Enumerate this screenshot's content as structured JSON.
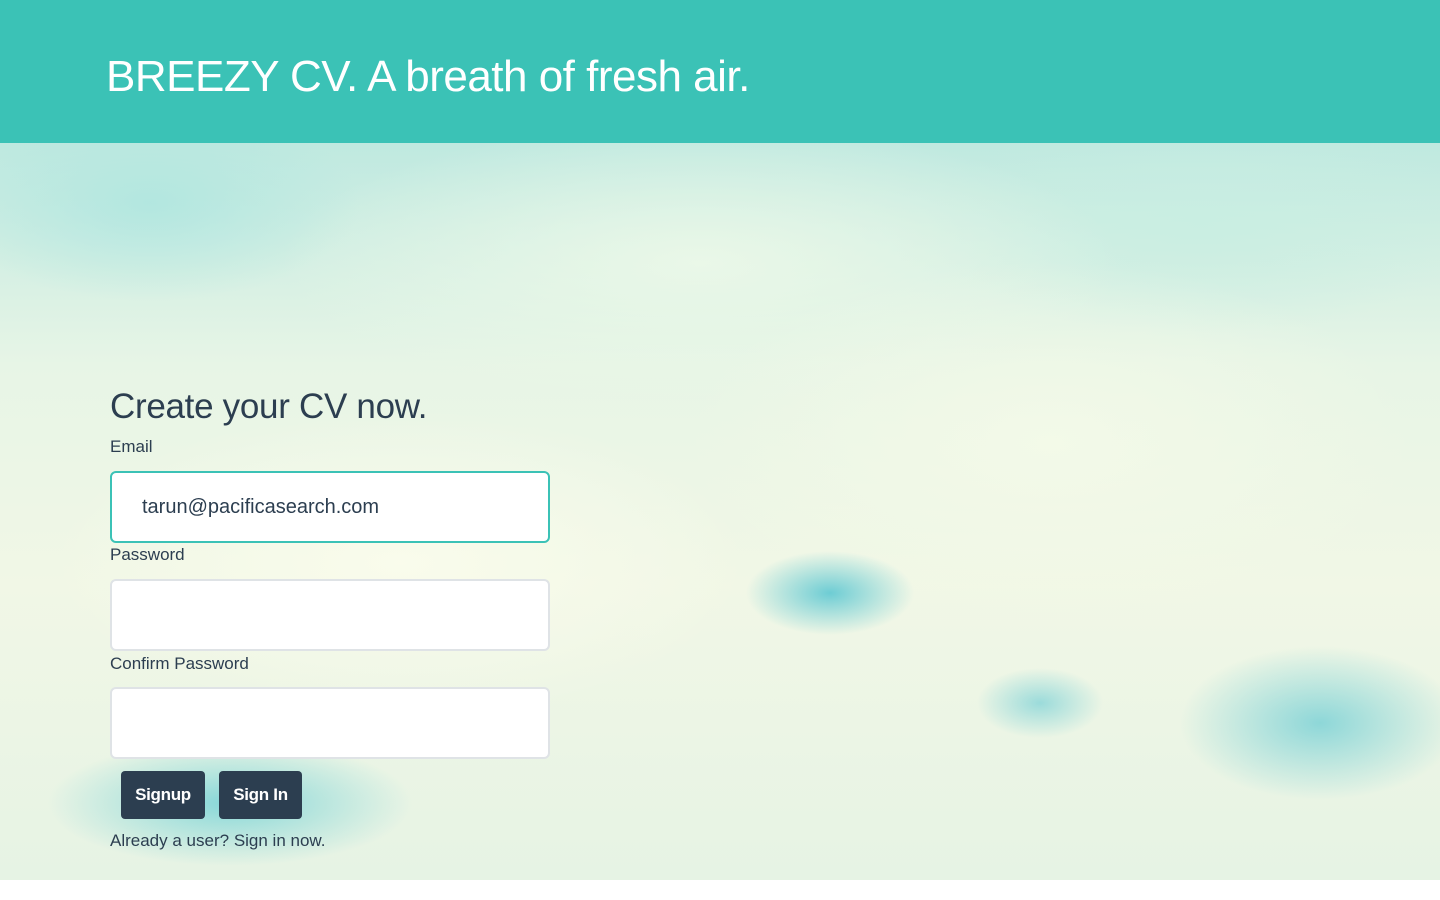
{
  "header": {
    "title": "BREEZY CV. A breath of fresh air."
  },
  "form": {
    "heading": "Create your CV now.",
    "email": {
      "label": "Email",
      "value": "tarun@pacificasearch.com"
    },
    "password": {
      "label": "Password",
      "value": ""
    },
    "confirm_password": {
      "label": "Confirm Password",
      "value": ""
    },
    "buttons": {
      "signup": "Signup",
      "signin": "Sign In"
    },
    "hint": {
      "prefix": "Already a user?",
      "link": "Sign in now."
    }
  },
  "colors": {
    "header_bg": "#3bc2b6",
    "button_bg": "#2c3e50",
    "text": "#2c3e50",
    "focus_border": "#3bc2b6"
  }
}
